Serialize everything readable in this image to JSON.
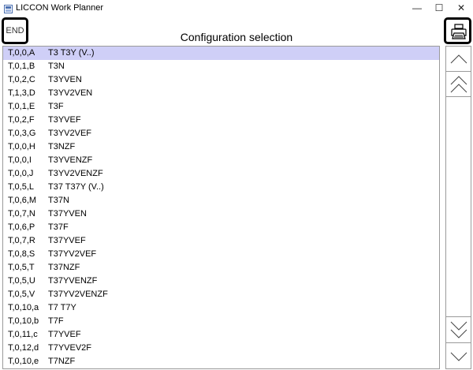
{
  "window": {
    "title": "LICCON Work Planner",
    "minimize": "—",
    "maximize": "☐",
    "close": "✕"
  },
  "header": {
    "end_label": "END",
    "title": "Configuration selection"
  },
  "list": {
    "rows": [
      {
        "code": "T,0,0,A",
        "desc": "T3 T3Y (V..)"
      },
      {
        "code": "T,0,1,B",
        "desc": "T3N"
      },
      {
        "code": "T,0,2,C",
        "desc": "T3YVEN"
      },
      {
        "code": "T,1,3,D",
        "desc": "T3YV2VEN"
      },
      {
        "code": "T,0,1,E",
        "desc": "T3F"
      },
      {
        "code": "T,0,2,F",
        "desc": "T3YVEF"
      },
      {
        "code": "T,0,3,G",
        "desc": "T3YV2VEF"
      },
      {
        "code": "T,0,0,H",
        "desc": "T3NZF"
      },
      {
        "code": "T,0,0,I",
        "desc": "T3YVENZF"
      },
      {
        "code": "T,0,0,J",
        "desc": "T3YV2VENZF"
      },
      {
        "code": "T,0,5,L",
        "desc": "T37 T37Y (V..)"
      },
      {
        "code": "T,0,6,M",
        "desc": "T37N"
      },
      {
        "code": "T,0,7,N",
        "desc": "T37YVEN"
      },
      {
        "code": "T,0,6,P",
        "desc": "T37F"
      },
      {
        "code": "T,0,7,R",
        "desc": "T37YVEF"
      },
      {
        "code": "T,0,8,S",
        "desc": "T37YV2VEF"
      },
      {
        "code": "T,0,5,T",
        "desc": "T37NZF"
      },
      {
        "code": "T,0,5,U",
        "desc": "T37YVENZF"
      },
      {
        "code": "T,0,5,V",
        "desc": "T37YV2VENZF"
      },
      {
        "code": "T,0,10,a",
        "desc": "T7 T7Y"
      },
      {
        "code": "T,0,10,b",
        "desc": "T7F"
      },
      {
        "code": "T,0,11,c",
        "desc": "T7YVEF"
      },
      {
        "code": "T,0,12,d",
        "desc": "T7YVEV2F"
      },
      {
        "code": "T,0,10,e",
        "desc": "T7NZF"
      }
    ],
    "selected_index": 0
  },
  "icons": {
    "app": "app-icon",
    "print": "printer-icon",
    "page_up": "chevron-up-icon",
    "page_up_fast": "double-chevron-up-icon",
    "page_down_fast": "double-chevron-down-icon",
    "page_down": "chevron-down-icon"
  },
  "colors": {
    "selection": "#cfcff7",
    "border": "#000000"
  }
}
